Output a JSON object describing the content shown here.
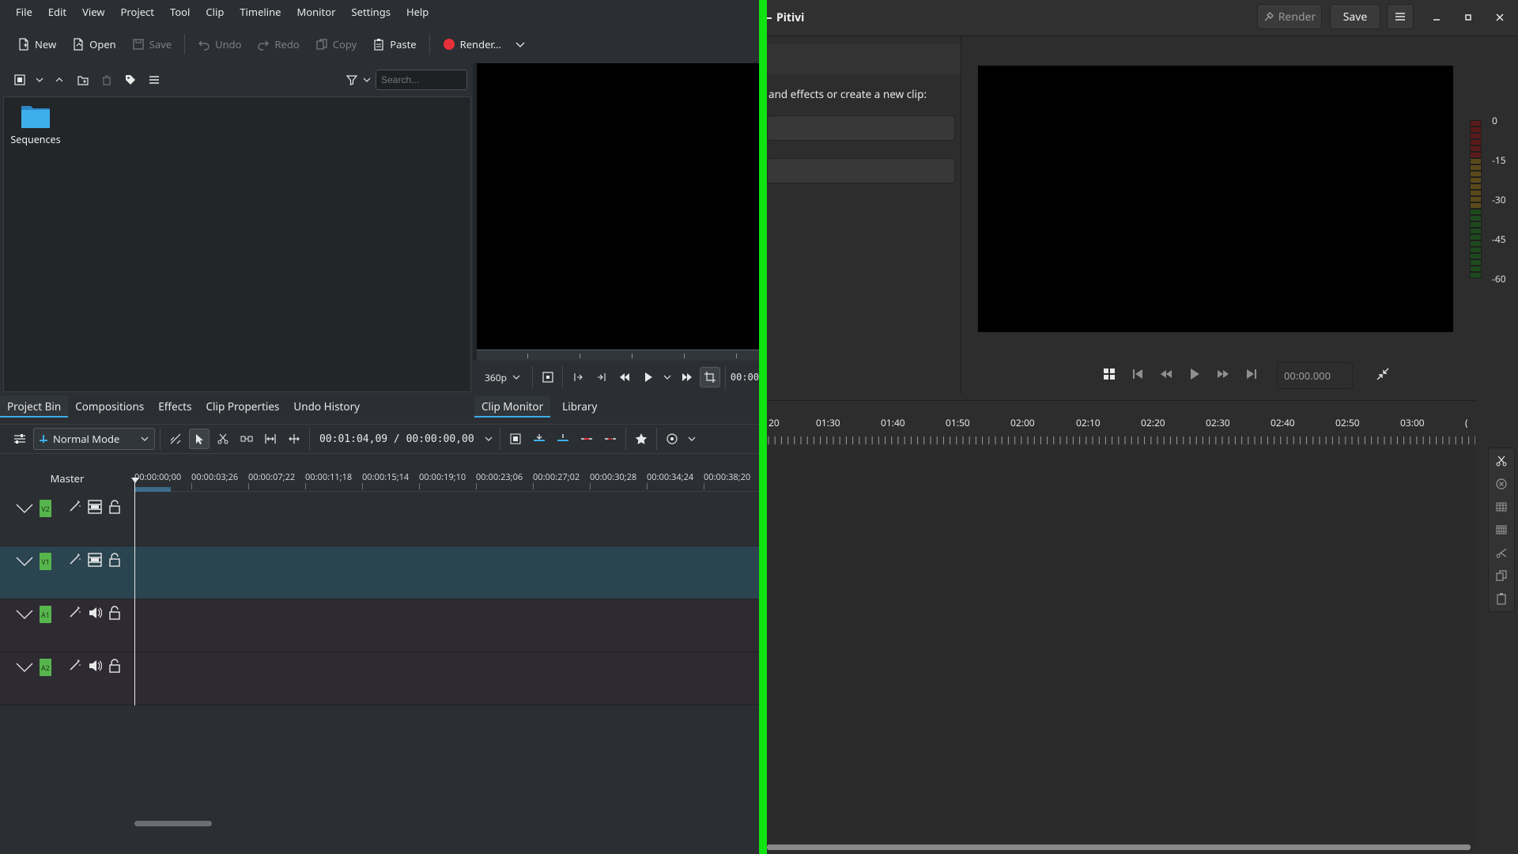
{
  "kdenlive": {
    "menu": [
      "File",
      "Edit",
      "View",
      "Project",
      "Tool",
      "Clip",
      "Timeline",
      "Monitor",
      "Settings",
      "Help"
    ],
    "toolbar": {
      "new": "New",
      "open": "Open",
      "save": "Save",
      "undo": "Undo",
      "redo": "Redo",
      "copy": "Copy",
      "paste": "Paste",
      "render": "Render..."
    },
    "bin": {
      "search_placeholder": "Search...",
      "folder_label": "Sequences"
    },
    "left_tabs": [
      "Project Bin",
      "Compositions",
      "Effects",
      "Clip Properties",
      "Undo History"
    ],
    "monitor": {
      "resolution": "360p",
      "timecode_partial": "00:00"
    },
    "right_tabs": [
      "Clip Monitor",
      "Library"
    ],
    "timeline": {
      "mode": "Normal Mode",
      "timecode": "00:01:04,09 / 00:00:00,00",
      "master_label": "Master",
      "ruler": [
        "00:00:00;00",
        "00:00:03;26",
        "00:00:07;22",
        "00:00:11;18",
        "00:00:15;14",
        "00:00:19;10",
        "00:00:23;06",
        "00:00:27;02",
        "00:00:30;28",
        "00:00:34;24",
        "00:00:38;20"
      ],
      "tracks": [
        {
          "id": "V2",
          "kind": "video"
        },
        {
          "id": "V1",
          "kind": "video"
        },
        {
          "id": "A1",
          "kind": "audio"
        },
        {
          "id": "A2",
          "kind": "audio"
        }
      ]
    },
    "colors": {
      "accent": "#3daee9",
      "track_badge": "#57b54d",
      "selected_track": "#2a4450"
    }
  },
  "pitivi": {
    "title": "Pitivi",
    "header": {
      "render": "Render",
      "save": "Save"
    },
    "hint": "and effects or create a new clip:",
    "timecode": "00:00.000",
    "meter_labels": [
      "0",
      "-15",
      "-30",
      "-45",
      "-60"
    ],
    "ruler": [
      "20",
      "01:30",
      "01:40",
      "01:50",
      "02:00",
      "02:10",
      "02:20",
      "02:30",
      "02:40",
      "02:50",
      "03:00",
      "("
    ]
  }
}
